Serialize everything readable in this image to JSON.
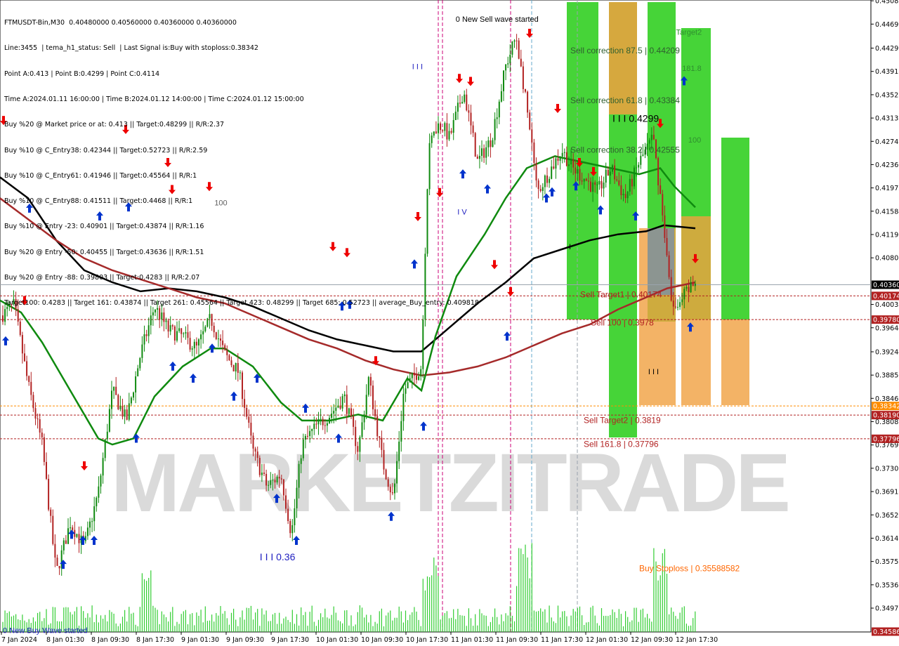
{
  "header_lines": [
    "FTMUSDT-Bin,M30  0.40480000 0.40560000 0.40360000 0.40360000",
    "Line:3455  | tema_h1_status: Sell  | Last Signal is:Buy with stoploss:0.38342",
    "Point A:0.413 | Point B:0.4299 | Point C:0.4114",
    "Time A:2024.01.11 16:00:00 | Time B:2024.01.12 14:00:00 | Time C:2024.01.12 15:00:00",
    "Buy %20 @ Market price or at: 0.413 || Target:0.48299 || R/R:2.37",
    "Buy %10 @ C_Entry38: 0.42344 || Target:0.52723 || R/R:2.59",
    "Buy %10 @ C_Entry61: 0.41946 || Target:0.45564 || R/R:1",
    "Buy %10 @ C_Entry88: 0.41511 || Target:0.4468 || R/R:1",
    "Buy %10 @ Entry -23: 0.40901 || Target:0.43874 || R/R:1.16",
    "Buy %20 @ Entry -50: 0.40455 || Target:0.43636 || R/R:1.51",
    "Buy %20 @ Entry -88: 0.39803 || Target:0.4283 || R/R:2.07",
    "Target100: 0.4283 || Target 161: 0.43874 || Target 261: 0.45564 || Target 423: 0.48299 || Target 685: 0.52723 || average_Buy_entry: 0.409818"
  ],
  "watermark": "MARKETZITRADE",
  "chart_data": {
    "type": "candlestick",
    "symbol": "FTMUSDT-Bin",
    "timeframe": "M30",
    "ohlc_last": {
      "open": 0.4048,
      "high": 0.4056,
      "low": 0.4036,
      "close": 0.4036
    },
    "y_axis_ticks": [
      "0.45087",
      "0.44699",
      "0.44299",
      "0.43911",
      "0.43523",
      "0.43135",
      "0.42747",
      "0.42360",
      "0.41972",
      "0.41584",
      "0.41196",
      "0.40808",
      "0.40032",
      "0.39644",
      "0.39244",
      "0.38856",
      "0.38469",
      "0.38081",
      "0.37693",
      "0.37305",
      "0.36917",
      "0.36529",
      "0.36141",
      "0.35753",
      "0.35365",
      "0.34977"
    ],
    "ylim": [
      0.3458,
      0.451
    ],
    "x_axis_ticks": [
      "7 Jan 2024",
      "8 Jan 01:30",
      "8 Jan 09:30",
      "8 Jan 17:30",
      "9 Jan 01:30",
      "9 Jan 09:30",
      "9 Jan 17:30",
      "10 Jan 01:30",
      "10 Jan 09:30",
      "10 Jan 17:30",
      "11 Jan 01:30",
      "11 Jan 09:30",
      "11 Jan 17:30",
      "12 Jan 01:30",
      "12 Jan 09:30",
      "12 Jan 17:30"
    ],
    "price_tags": [
      {
        "label": "0.40360",
        "value": 0.4036,
        "bg": "#000000",
        "fg": "#ffffff"
      },
      {
        "label": "0.40174",
        "value": 0.40174,
        "bg": "#b22222",
        "fg": "#ffffff"
      },
      {
        "label": "0.39780",
        "value": 0.3978,
        "bg": "#b22222",
        "fg": "#ffffff"
      },
      {
        "label": "0.38342",
        "value": 0.38342,
        "bg": "#ff8c00",
        "fg": "#ffffff"
      },
      {
        "label": "0.38190",
        "value": 0.3819,
        "bg": "#b22222",
        "fg": "#ffffff"
      },
      {
        "label": "0.37796",
        "value": 0.37796,
        "bg": "#b22222",
        "fg": "#ffffff"
      },
      {
        "label": "0.34586",
        "value": 0.34586,
        "bg": "#b22222",
        "fg": "#ffffff"
      }
    ],
    "level_lines": [
      {
        "value": 0.4036,
        "color": "#9aa3ad",
        "dash": false
      },
      {
        "value": 0.40174,
        "color": "#b22222",
        "dash": true
      },
      {
        "value": 0.3978,
        "color": "#b22222",
        "dash": true
      },
      {
        "value": 0.38342,
        "color": "#ff8c00",
        "dash": true
      },
      {
        "value": 0.3819,
        "color": "#b22222",
        "dash": true
      },
      {
        "value": 0.37796,
        "color": "#b22222",
        "dash": true
      }
    ],
    "zone_labels": [
      {
        "text": "Sell correction 87.5 | 0.44209",
        "value": 0.4421,
        "color": "#2f5f2f"
      },
      {
        "text": "Sell correction 61.8 | 0.43384",
        "value": 0.4338,
        "color": "#2f5f2f"
      },
      {
        "text": "Sell correction 38.2 | 0.42555",
        "value": 0.4256,
        "color": "#2f5f2f"
      },
      {
        "text": "Sell Target1 | 0.40174",
        "value": 0.4015,
        "color": "#b22222"
      },
      {
        "text": "Sell 100 | 0.3978",
        "value": 0.3968,
        "color": "#b22222"
      },
      {
        "text": "Sell Target2 | 0.3819",
        "value": 0.3806,
        "color": "#b22222"
      },
      {
        "text": "Sell 161.8 | 0.37796",
        "value": 0.3766,
        "color": "#b22222"
      },
      {
        "text": "Buy Stoploss | 0.35588582",
        "value": 0.3559,
        "color": "#ff6600"
      }
    ],
    "annotations": [
      {
        "text": "0 New Sell wave started",
        "x": 0.52,
        "value": 0.4474,
        "color": "#000000"
      },
      {
        "text": "0 New Buy Wave started",
        "x": 0.0,
        "value": 0.3456,
        "color": "#2020c0"
      },
      {
        "text": "I I I 0.36",
        "x": 0.295,
        "value": 0.3577,
        "color": "#2020c0"
      },
      {
        "text": "I I I 0.4299",
        "x": 0.7,
        "value": 0.4307,
        "color": "#000000"
      },
      {
        "text": "Target2",
        "x": 0.773,
        "value": 0.4452,
        "color": "#2f8f2f"
      },
      {
        "text": "181.8",
        "x": 0.78,
        "value": 0.4392,
        "color": "#2f8f2f"
      },
      {
        "text": "100",
        "x": 0.787,
        "value": 0.4273,
        "color": "#2f8f2f"
      },
      {
        "text": "100",
        "x": 0.243,
        "value": 0.4168,
        "color": "#606060"
      },
      {
        "text": "I V",
        "x": 0.522,
        "value": 0.4153,
        "color": "#2020c0"
      },
      {
        "text": "I I I",
        "x": 0.47,
        "value": 0.4395,
        "color": "#2020c0"
      },
      {
        "text": "I I I",
        "x": 0.741,
        "value": 0.3887,
        "color": "#000000"
      },
      {
        "text": "I",
        "x": 0.65,
        "value": 0.4095,
        "color": "#000000"
      }
    ],
    "colors": {
      "ma_green": "#0f8a0f",
      "ma_black": "#000000",
      "ma_red": "#a52a2a",
      "bull": "#0f8a0f",
      "bear": "#b22222",
      "volume": "#32cd32",
      "zone_green": "#3cd22d",
      "zone_orange": "#f0a040",
      "zone_gray": "#8090a0",
      "arrow_up": "#0033cc",
      "arrow_down": "#ee0000"
    }
  }
}
